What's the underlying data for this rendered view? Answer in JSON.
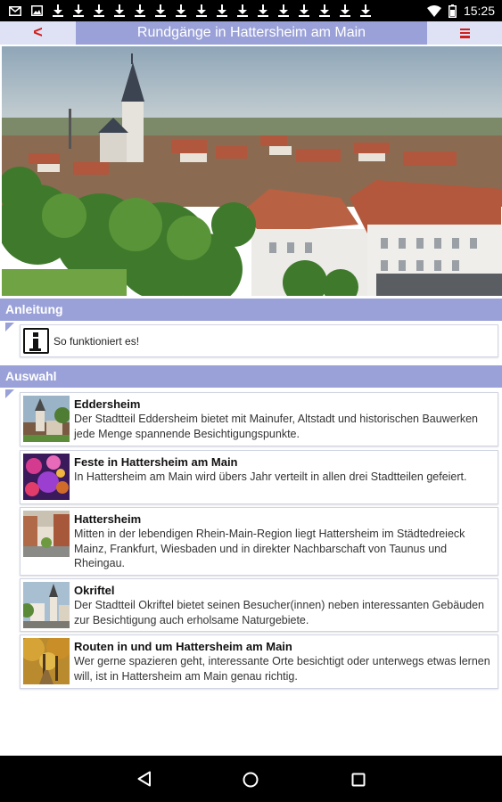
{
  "status_bar": {
    "time": "15:25",
    "icons": [
      "mail-icon",
      "image-icon",
      "download-icon",
      "download-icon",
      "download-icon",
      "download-icon",
      "download-icon",
      "download-icon",
      "download-icon",
      "download-icon",
      "download-icon",
      "download-icon",
      "download-icon",
      "download-icon",
      "download-icon",
      "download-icon",
      "download-icon",
      "download-icon",
      "download-icon",
      "download-icon",
      "wifi-icon",
      "battery-icon"
    ]
  },
  "app_bar": {
    "back_label": "<",
    "title": "Rundgänge in Hattersheim am Main",
    "accent_color": "#9aa1d8",
    "icon_color": "#d0201e"
  },
  "sections": {
    "instructions": {
      "header": "Anleitung",
      "item_label": "So funktioniert es!"
    },
    "selection": {
      "header": "Auswahl",
      "items": [
        {
          "title": "Eddersheim",
          "description": "Der Stadtteil Eddersheim bietet mit Mainufer, Altstadt und historischen Bauwerken jede Menge spannende Besichtigungspunkte."
        },
        {
          "title": "Feste in Hattersheim am Main",
          "description": "In Hattersheim am Main wird übers Jahr verteilt in allen drei Stadtteilen gefeiert."
        },
        {
          "title": "Hattersheim",
          "description": "Mitten in der lebendigen Rhein-Main-Region liegt Hattersheim im Städtedreieck Mainz, Frankfurt, Wiesbaden und in direkter Nachbarschaft von Taunus und Rheingau."
        },
        {
          "title": "Okriftel",
          "description": "Der Stadtteil Okriftel bietet seinen Besucher(innen) neben interessanten Gebäuden zur Besichtigung auch erholsame Naturgebiete."
        },
        {
          "title": "Routen in und um Hattersheim am Main",
          "description": "Wer gerne spazieren geht, interessante Orte besichtigt oder unterwegs etwas lernen will, ist in Hattersheim am Main genau richtig."
        }
      ]
    }
  }
}
